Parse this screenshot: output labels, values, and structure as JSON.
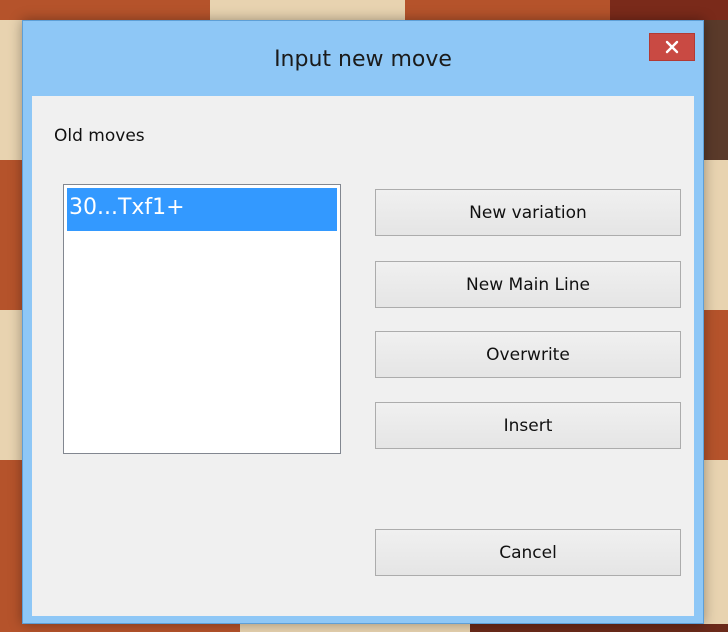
{
  "dialog": {
    "title": "Input new move",
    "close_label": "close"
  },
  "old_moves": {
    "label": "Old moves",
    "items": [
      "30...Txf1+"
    ],
    "selected_index": 0
  },
  "buttons": {
    "new_variation": "New variation",
    "new_main_line": "New Main Line",
    "overwrite": "Overwrite",
    "insert": "Insert",
    "cancel": "Cancel"
  },
  "colors": {
    "titlebar": "#8ec7f6",
    "close_button": "#c94a43",
    "selection": "#3399ff",
    "client_bg": "#f0f0f0"
  }
}
